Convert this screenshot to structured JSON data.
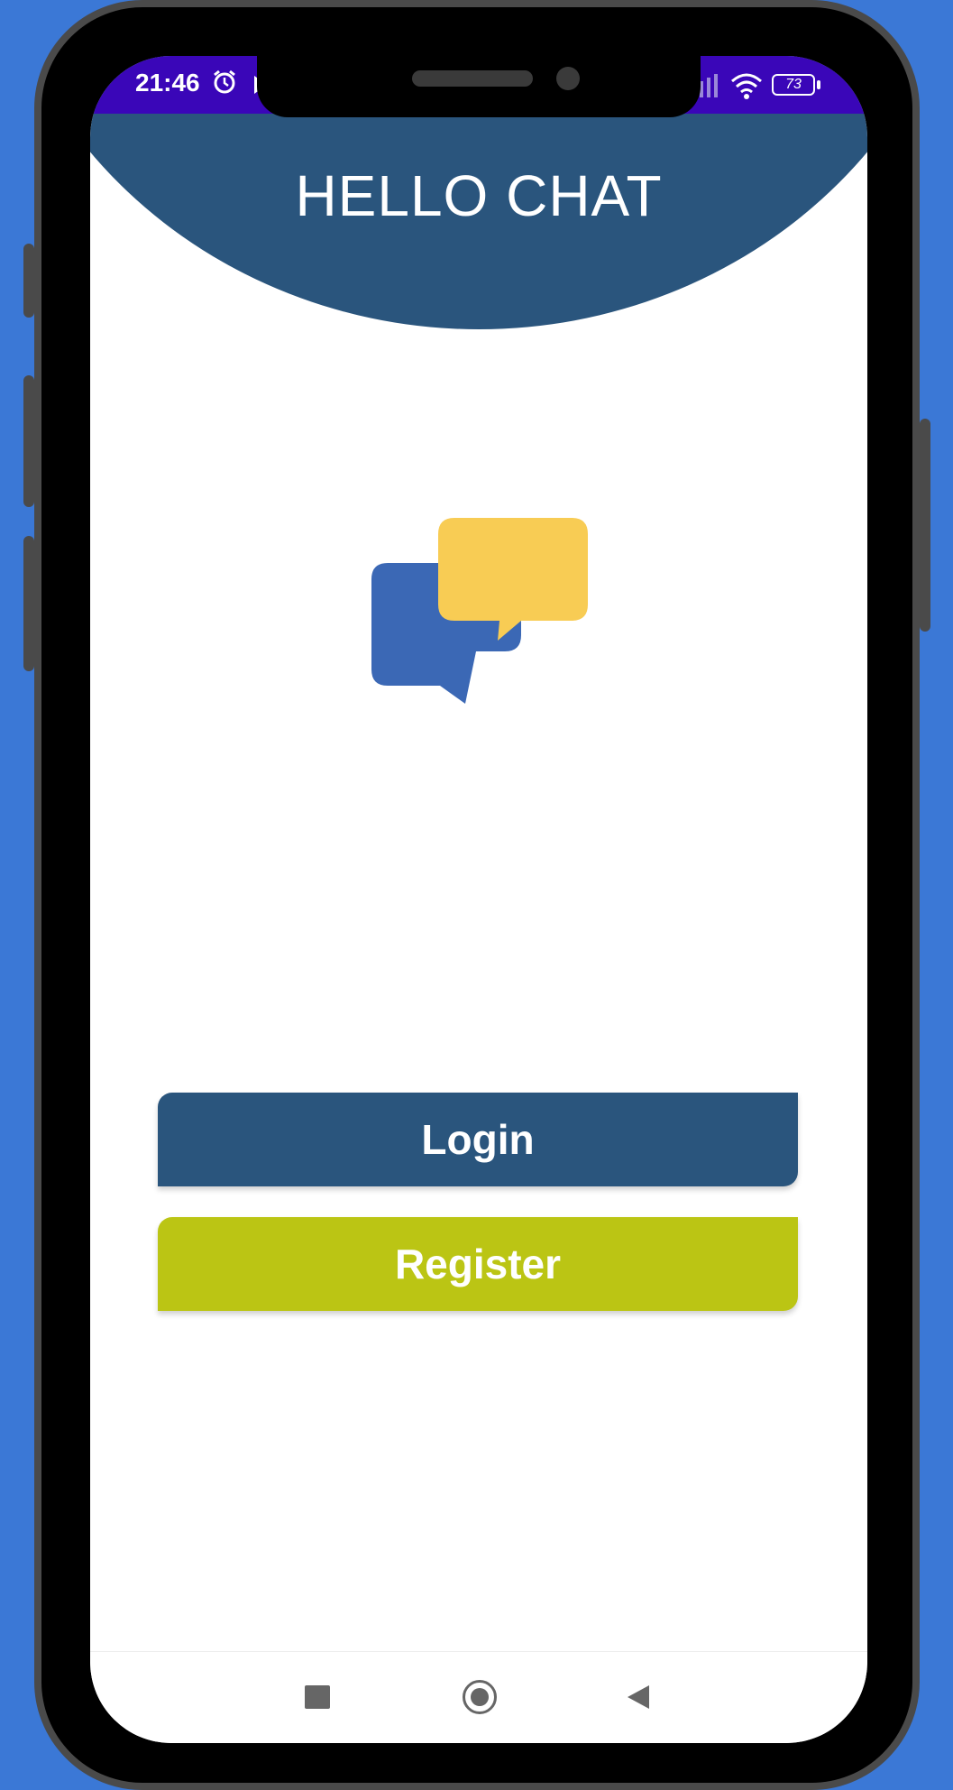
{
  "status_bar": {
    "time": "21:46",
    "battery": "73",
    "color": "#3a06b8"
  },
  "header": {
    "title": "HELLO CHAT",
    "color": "#2a557d"
  },
  "logo": {
    "icon": "chat-bubbles-icon",
    "colors": {
      "back_bubble": "#3b68b5",
      "front_bubble": "#f8cc54"
    }
  },
  "buttons": {
    "login_label": "Login",
    "register_label": "Register",
    "login_color": "#2a557d",
    "register_color": "#bbc514"
  },
  "nav": {
    "recents_icon": "square-icon",
    "home_icon": "circle-icon",
    "back_icon": "triangle-back-icon"
  }
}
